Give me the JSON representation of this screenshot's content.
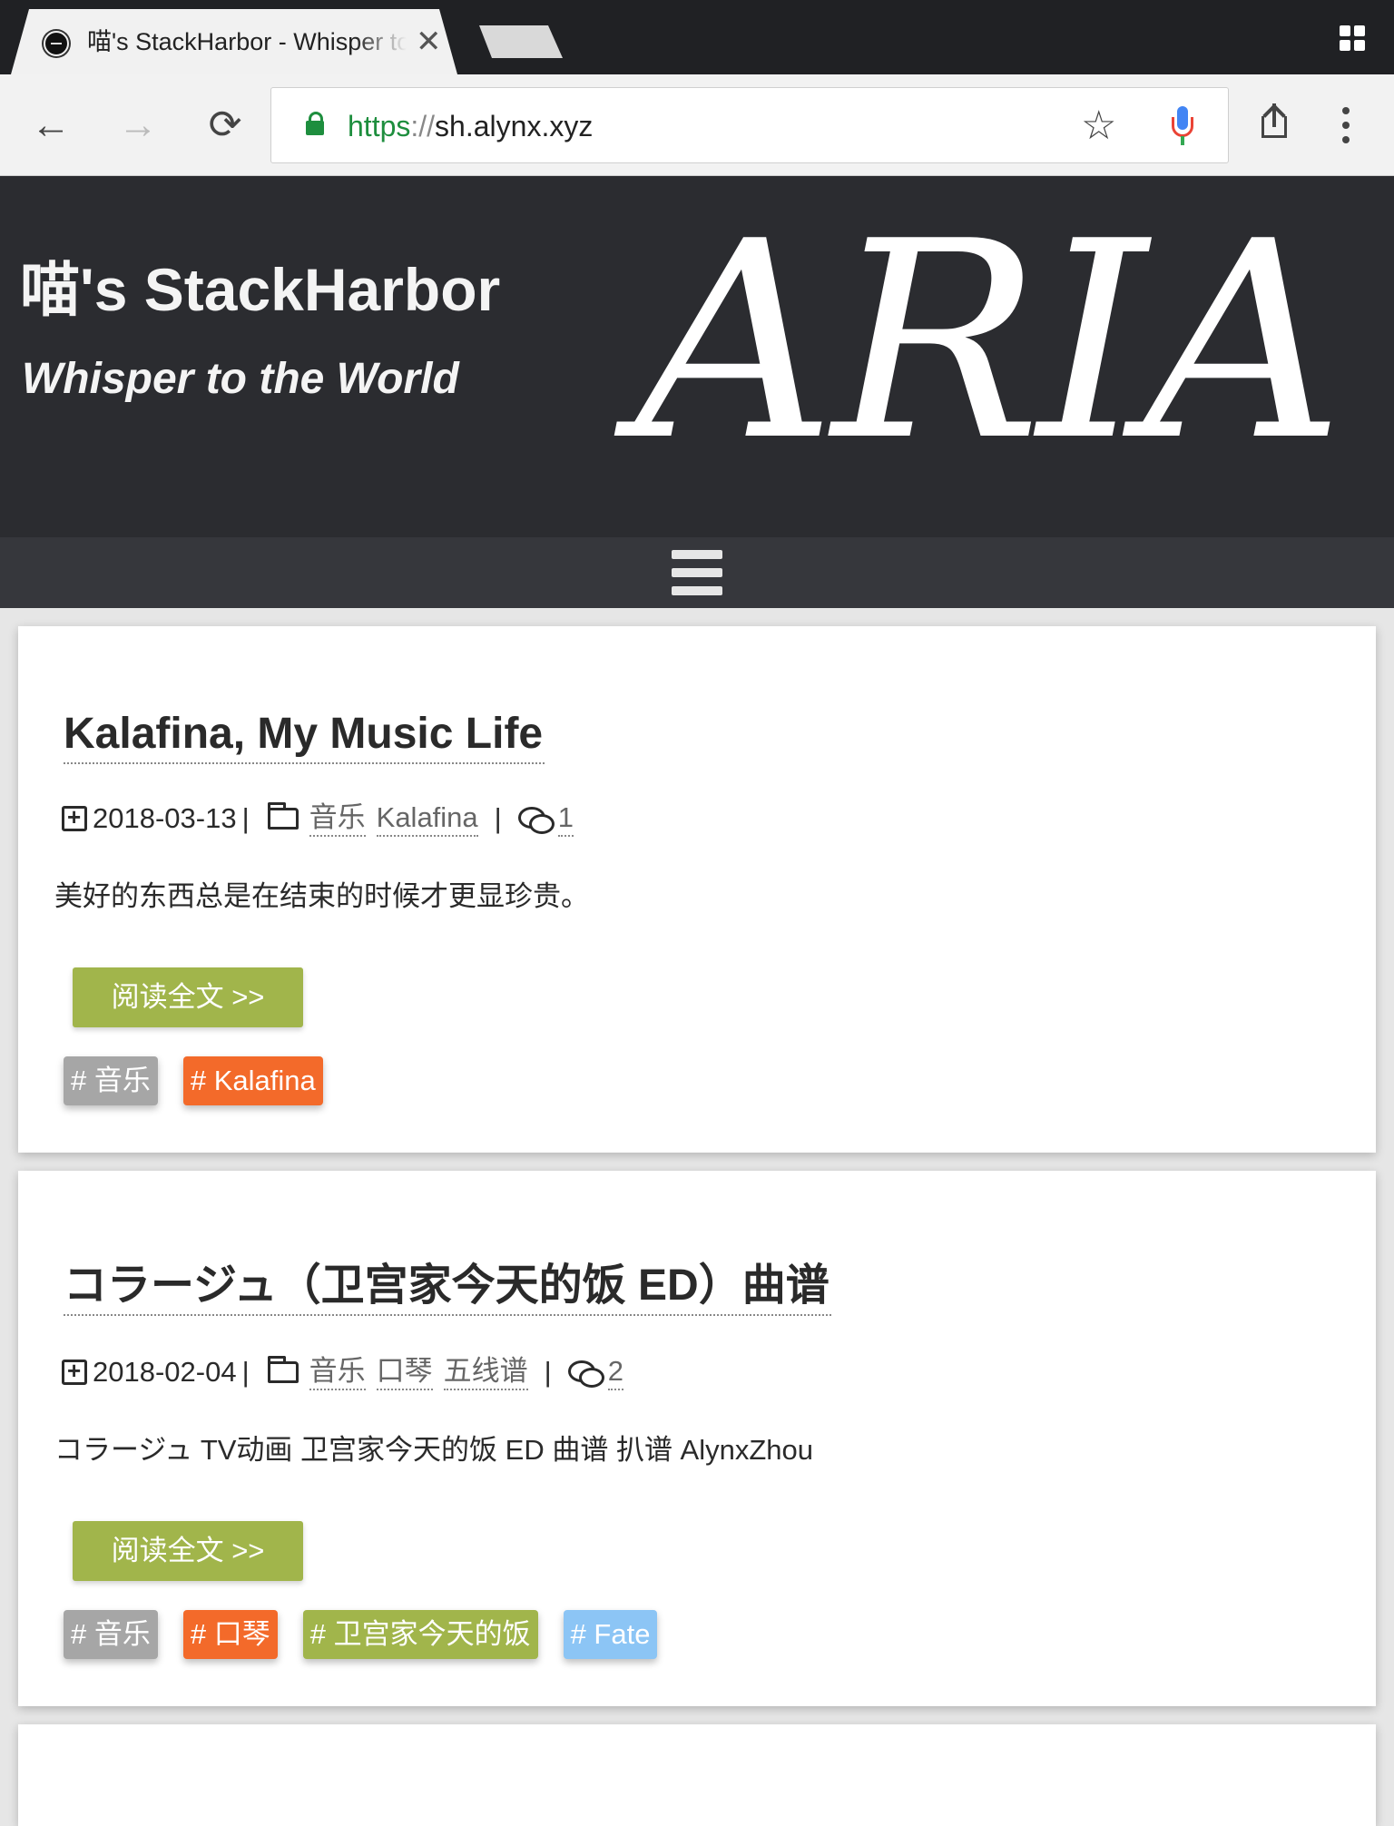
{
  "browser": {
    "tab_title": "喵's StackHarbor - Whisper to the World",
    "close_glyph": "✕",
    "url": {
      "scheme": "https",
      "separator": "://",
      "host": "sh.alynx.xyz"
    }
  },
  "site": {
    "title": "喵's StackHarbor",
    "subtitle": "Whisper to the World",
    "logo_text": "ARIA"
  },
  "posts": [
    {
      "title": "Kalafina, My Music Life",
      "date": "2018-03-13",
      "categories": [
        "音乐",
        "Kalafina"
      ],
      "comment_count": "1",
      "excerpt": "美好的东西总是在结束的时候才更显珍贵。",
      "read_more": "阅读全文 >>",
      "tags": [
        {
          "label": "# 音乐",
          "color": "#a6a6a6"
        },
        {
          "label": "# Kalafina",
          "color": "#f36a2a"
        }
      ]
    },
    {
      "title": "コラージュ（卫宫家今天的饭 ED）曲谱",
      "date": "2018-02-04",
      "categories": [
        "音乐",
        "口琴",
        "五线谱"
      ],
      "comment_count": "2",
      "excerpt": "コラージュ TV动画 卫宫家今天的饭 ED 曲谱 扒谱 AlynxZhou",
      "read_more": "阅读全文 >>",
      "tags": [
        {
          "label": "# 音乐",
          "color": "#a6a6a6"
        },
        {
          "label": "# 口琴",
          "color": "#f36a2a"
        },
        {
          "label": "# 卫宫家今天的饭",
          "color": "#a1b54b"
        },
        {
          "label": "# Fate",
          "color": "#8cc5f5"
        }
      ]
    }
  ],
  "colors": {
    "header_bg": "#2b2c30",
    "nav_bg": "#36373c",
    "read_more_bg": "#a1b54b",
    "secure_green": "#1e8e3e"
  }
}
